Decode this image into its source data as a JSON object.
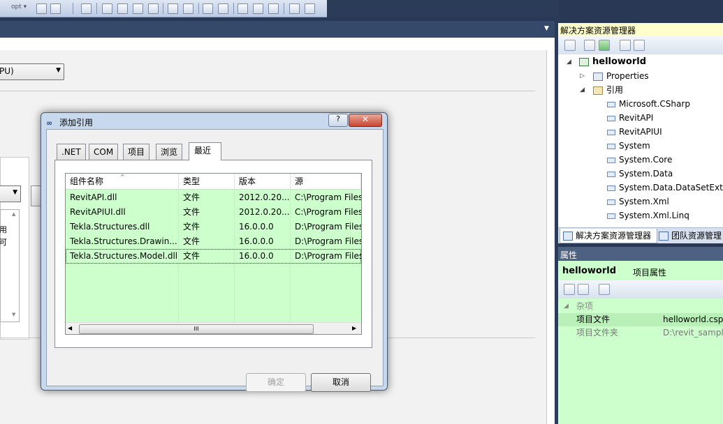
{
  "toolbar": {
    "opt_label": "opt ▾"
  },
  "main": {
    "config_select": "PU)"
  },
  "dialog": {
    "title": "添加引用",
    "help": "?",
    "close": "✕",
    "tabs": [
      ".NET",
      "COM",
      "项目",
      "浏览",
      "最近"
    ],
    "active_tab": "最近",
    "columns": [
      "组件名称",
      "类型",
      "版本",
      "源"
    ],
    "rows": [
      {
        "name": "RevitAPI.dll",
        "type": "文件",
        "version": "2012.0.20...",
        "source": "C:\\Program Files"
      },
      {
        "name": "RevitAPIUI.dll",
        "type": "文件",
        "version": "2012.0.20...",
        "source": "C:\\Program Files"
      },
      {
        "name": "Tekla.Structures.dll",
        "type": "文件",
        "version": "16.0.0.0",
        "source": "D:\\Program Files"
      },
      {
        "name": "Tekla.Structures.Drawin...",
        "type": "文件",
        "version": "16.0.0.0",
        "source": "D:\\Program Files"
      },
      {
        "name": "Tekla.Structures.Model.dll",
        "type": "文件",
        "version": "16.0.0.0",
        "source": "D:\\Program Files"
      }
    ],
    "selected_row": 4,
    "scroll_thumb_label": "III",
    "ok_label": "确定",
    "cancel_label": "取消"
  },
  "solution_explorer": {
    "title": "解决方案资源管理器",
    "project": "helloworld",
    "properties_node": "Properties",
    "references_node": "引用",
    "references": [
      "Microsoft.CSharp",
      "RevitAPI",
      "RevitAPIUI",
      "System",
      "System.Core",
      "System.Data",
      "System.Data.DataSetExten",
      "System.Xml",
      "System.Xml.Linq"
    ],
    "tabs": [
      "解决方案资源管理器",
      "团队资源管理"
    ]
  },
  "properties": {
    "title": "属性",
    "object_name": "helloworld",
    "object_suffix": "项目属性",
    "category": "杂项",
    "rows": [
      {
        "name": "项目文件",
        "value": "helloworld.cspr"
      },
      {
        "name": "项目文件夹",
        "value": "D:\\revit_sample"
      }
    ]
  },
  "colors": {
    "highlight_green": "#ccffcc",
    "title_yellow": "#ffffcc",
    "ide_dark": "#293955"
  }
}
